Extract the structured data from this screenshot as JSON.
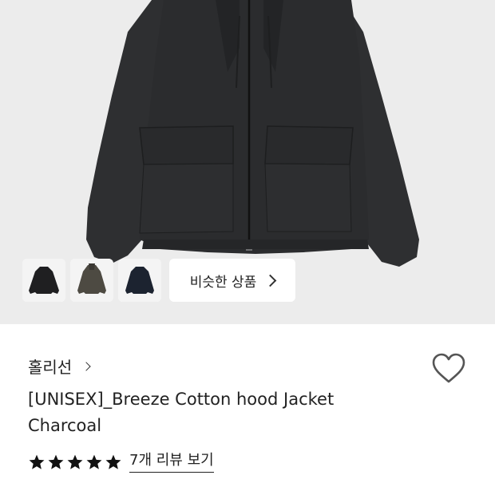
{
  "thumbnails": [
    {
      "icon": "jacket-black-thumbnail"
    },
    {
      "icon": "jacket-khaki-thumbnail"
    },
    {
      "icon": "jacket-navy-thumbnail"
    }
  ],
  "similar_products": {
    "label": "비슷한 상품",
    "icon": "chevron-right-icon"
  },
  "product": {
    "brand": "홀리선",
    "title_line1": "[UNISEX]_Breeze Cotton hood Jacket",
    "title_line2": "Charcoal",
    "rating": 5,
    "reviews_label": "7개 리뷰 보기"
  },
  "colors": {
    "hero_bg": "#ececec",
    "jacket": "#2b2c2e",
    "text": "#222222"
  }
}
